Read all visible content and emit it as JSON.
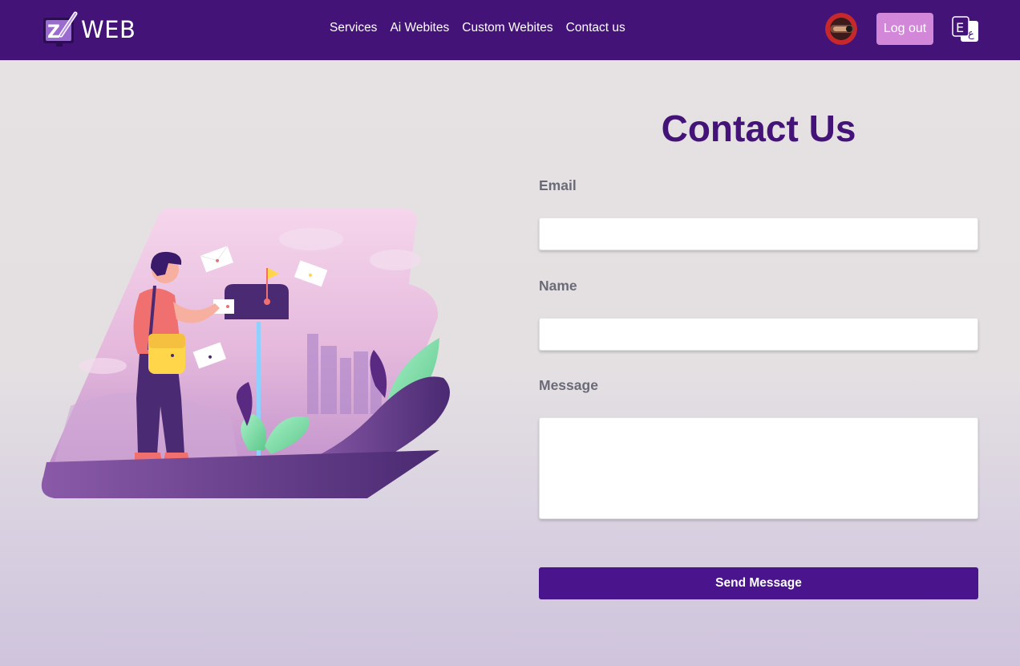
{
  "header": {
    "brand_text": "WEB",
    "nav": [
      "Services",
      "Ai Webites",
      "Custom Webites",
      "Contact us"
    ],
    "logout_label": "Log out",
    "language_icon": "language-toggle-icon"
  },
  "contact": {
    "title": "Contact Us",
    "fields": {
      "email_label": "Email",
      "name_label": "Name",
      "message_label": "Message",
      "email_value": "",
      "name_value": "",
      "message_value": ""
    },
    "send_label": "Send Message"
  },
  "colors": {
    "navbar": "#431378",
    "accent": "#4a148c",
    "logout_bg": "#d287d8",
    "title": "#431378"
  }
}
